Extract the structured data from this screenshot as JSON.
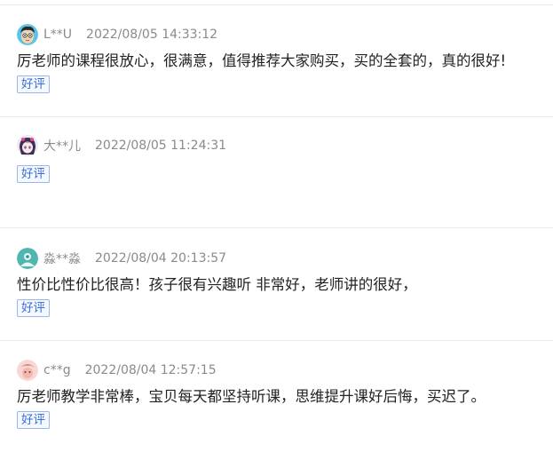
{
  "reviews": [
    {
      "username": "L**U",
      "timestamp": "2022/08/05 14:33:12",
      "comment": "厉老师的课程很放心，很满意，值得推荐大家购买，买的全套的，真的很好!",
      "tag": "好评",
      "avatar_icon": "cartoon-boy-avatar-icon"
    },
    {
      "username": "大**儿",
      "timestamp": "2022/08/05 11:24:31",
      "comment": "",
      "tag": "好评",
      "avatar_icon": "anime-girl-avatar-icon"
    },
    {
      "username": "淼**淼",
      "timestamp": "2022/08/04 20:13:57",
      "comment": "性价比性价比很高！孩子很有兴趣听 非常好，老师讲的很好，",
      "tag": "好评",
      "avatar_icon": "teal-default-avatar-icon"
    },
    {
      "username": "c**g",
      "timestamp": "2022/08/04 12:57:15",
      "comment": "厉老师教学非常棒，宝贝每天都坚持听课，思维提升课好后悔，买迟了。",
      "tag": "好评",
      "avatar_icon": "pink-photo-avatar-icon"
    }
  ],
  "colors": {
    "meta_text": "#8a8a8a",
    "body_text": "#222222",
    "tag_text": "#3b6fd6",
    "tag_border": "#9bb6ea",
    "divider": "#ebebeb"
  }
}
